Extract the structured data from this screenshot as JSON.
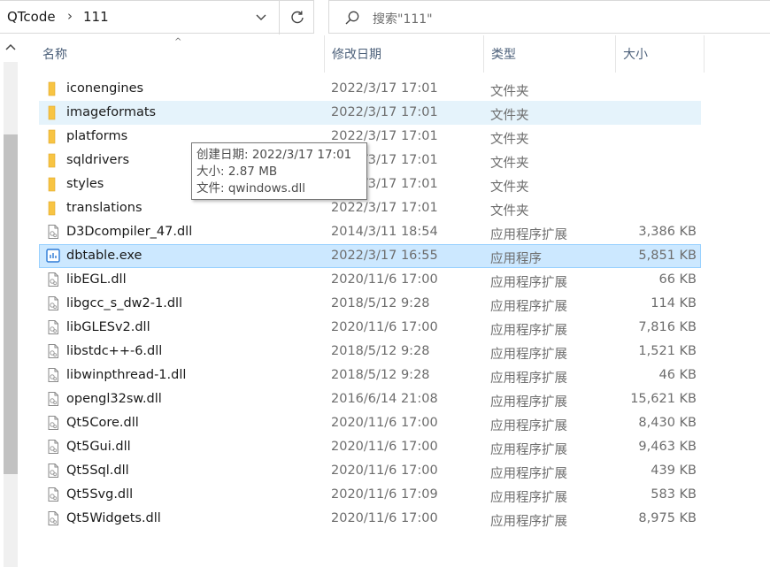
{
  "address": {
    "segments": [
      "QTcode",
      "111"
    ],
    "separator": "›"
  },
  "search": {
    "placeholder": "搜索\"111\""
  },
  "columns": {
    "name": "名称",
    "date": "修改日期",
    "type": "类型",
    "size": "大小"
  },
  "files": [
    {
      "name": "iconengines",
      "date": "2022/3/17 17:01",
      "type": "文件夹",
      "size": "",
      "icon": "folder-icon"
    },
    {
      "name": "imageformats",
      "date": "2022/3/17 17:01",
      "type": "文件夹",
      "size": "",
      "icon": "folder-icon"
    },
    {
      "name": "platforms",
      "date": "2022/3/17 17:01",
      "type": "文件夹",
      "size": "",
      "icon": "folder-icon"
    },
    {
      "name": "sqldrivers",
      "date": "2022/3/17 17:01",
      "type": "文件夹",
      "size": "",
      "icon": "folder-icon"
    },
    {
      "name": "styles",
      "date": "2022/3/17 17:01",
      "type": "文件夹",
      "size": "",
      "icon": "folder-icon"
    },
    {
      "name": "translations",
      "date": "2022/3/17 17:01",
      "type": "文件夹",
      "size": "",
      "icon": "folder-icon"
    },
    {
      "name": "D3Dcompiler_47.dll",
      "date": "2014/3/11 18:54",
      "type": "应用程序扩展",
      "size": "3,386 KB",
      "icon": "dll-file-icon"
    },
    {
      "name": "dbtable.exe",
      "date": "2022/3/17 16:55",
      "type": "应用程序",
      "size": "5,851 KB",
      "icon": "exe-file-icon"
    },
    {
      "name": "libEGL.dll",
      "date": "2020/11/6 17:00",
      "type": "应用程序扩展",
      "size": "66 KB",
      "icon": "dll-file-icon"
    },
    {
      "name": "libgcc_s_dw2-1.dll",
      "date": "2018/5/12 9:28",
      "type": "应用程序扩展",
      "size": "114 KB",
      "icon": "dll-file-icon"
    },
    {
      "name": "libGLESv2.dll",
      "date": "2020/11/6 17:00",
      "type": "应用程序扩展",
      "size": "7,816 KB",
      "icon": "dll-file-icon"
    },
    {
      "name": "libstdc++-6.dll",
      "date": "2018/5/12 9:28",
      "type": "应用程序扩展",
      "size": "1,521 KB",
      "icon": "dll-file-icon"
    },
    {
      "name": "libwinpthread-1.dll",
      "date": "2018/5/12 9:28",
      "type": "应用程序扩展",
      "size": "46 KB",
      "icon": "dll-file-icon"
    },
    {
      "name": "opengl32sw.dll",
      "date": "2016/6/14 21:08",
      "type": "应用程序扩展",
      "size": "15,621 KB",
      "icon": "dll-file-icon"
    },
    {
      "name": "Qt5Core.dll",
      "date": "2020/11/6 17:00",
      "type": "应用程序扩展",
      "size": "8,430 KB",
      "icon": "dll-file-icon"
    },
    {
      "name": "Qt5Gui.dll",
      "date": "2020/11/6 17:00",
      "type": "应用程序扩展",
      "size": "9,463 KB",
      "icon": "dll-file-icon"
    },
    {
      "name": "Qt5Sql.dll",
      "date": "2020/11/6 17:00",
      "type": "应用程序扩展",
      "size": "439 KB",
      "icon": "dll-file-icon"
    },
    {
      "name": "Qt5Svg.dll",
      "date": "2020/11/6 17:09",
      "type": "应用程序扩展",
      "size": "583 KB",
      "icon": "dll-file-icon"
    },
    {
      "name": "Qt5Widgets.dll",
      "date": "2020/11/6 17:00",
      "type": "应用程序扩展",
      "size": "8,975 KB",
      "icon": "dll-file-icon"
    }
  ],
  "hovered_row": "imageformats",
  "selected_row": "dbtable.exe",
  "tooltip": {
    "created": "创建日期: 2022/3/17 17:01",
    "size": "大小: 2.87 MB",
    "files": "文件: qwindows.dll"
  },
  "colors": {
    "folder": "#f8c443",
    "hover_bg": "#e5f3fb",
    "selected_bg": "#cce8ff",
    "selected_border": "#99d1ff",
    "exe_accent": "#2e7bd6"
  }
}
